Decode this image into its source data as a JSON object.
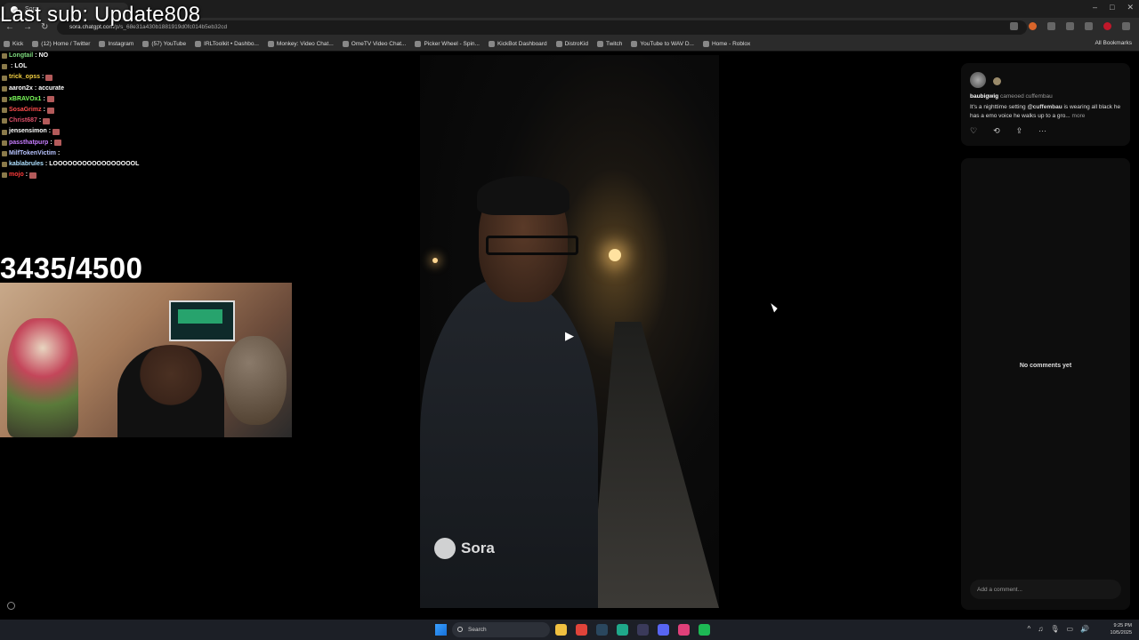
{
  "browser": {
    "tab_title": "Sora",
    "url_host": "sora.chatgpt.com",
    "url_path": "/p/s_68e31a430b1881919d0fc014b5eb32cd",
    "window_controls": [
      "–",
      "□",
      "✕"
    ],
    "nav": [
      "←",
      "→",
      "↻"
    ],
    "bookmarks": [
      "Kick",
      "(12) Home / Twitter",
      "Instagram",
      "(57) YouTube",
      "IRLToolkit • Dashbo...",
      "Monkey: Video Chat...",
      "OmeTV Video Chat...",
      "Picker Wheel - Spin...",
      "KickBot Dashboard",
      "DistroKid",
      "Twitch",
      "YouTube to WAV D...",
      "Home - Roblox"
    ],
    "all_bookmarks": "All Bookmarks"
  },
  "overlay": {
    "last_sub": "Last sub: Update808",
    "counter": "3435/4500",
    "chat": [
      {
        "user": "Longtail",
        "color": "#7dd87d",
        "msg": "NO",
        "emote": false
      },
      {
        "user": "",
        "color": "#ff5c8a",
        "msg": "LOL",
        "emote": false
      },
      {
        "user": "trick_opss",
        "color": "#f5d142",
        "msg": "",
        "emote": true
      },
      {
        "user": "aaron2x",
        "color": "#ffffff",
        "msg": "accurate",
        "emote": false
      },
      {
        "user": "xBRAVOx1",
        "color": "#7dff5c",
        "msg": "",
        "emote": true
      },
      {
        "user": "SosaGrimz",
        "color": "#ff4d4d",
        "msg": "",
        "emote": true
      },
      {
        "user": "Christ687",
        "color": "#e0506a",
        "msg": "",
        "emote": true
      },
      {
        "user": "jensensimon",
        "color": "#ffffff",
        "msg": "",
        "emote": true
      },
      {
        "user": "passthatpurp",
        "color": "#c77dff",
        "msg": "",
        "emote": true
      },
      {
        "user": "MilfTokenVictim",
        "color": "#b8c4ff",
        "msg": "",
        "emote": false
      },
      {
        "user": "kablabrules",
        "color": "#aee0ff",
        "msg": "LOOOOOOOOOOOOOOOOOL",
        "emote": false
      },
      {
        "user": "mojo",
        "color": "#ff3b3b",
        "msg": "",
        "emote": true
      }
    ]
  },
  "video": {
    "watermark": "Sora",
    "play_icon": "▶"
  },
  "post": {
    "username": "baubigwig",
    "action": "cameoed cuffembau",
    "text_prefix": "It's a nighttime setting ",
    "mention": "@cuffembau",
    "text_suffix": " is wearing all black he has a emo voice he walks up to a gro...",
    "more": "more",
    "actions": [
      "♡",
      "⟲",
      "⇪",
      "···"
    ]
  },
  "comments": {
    "empty_text": "No comments yet",
    "input_placeholder": "Add a comment..."
  },
  "taskbar": {
    "search_label": "Search",
    "apps": [
      {
        "name": "file-explorer-icon",
        "color": "#f0c040"
      },
      {
        "name": "chrome-icon",
        "color": "#e0443a"
      },
      {
        "name": "steam-icon",
        "color": "#2a475e"
      },
      {
        "name": "app-green-icon",
        "color": "#1fa88a"
      },
      {
        "name": "obs-icon",
        "color": "#3a3a5a"
      },
      {
        "name": "discord-icon",
        "color": "#5865f2"
      },
      {
        "name": "app-pink-icon",
        "color": "#e0407a"
      },
      {
        "name": "spotify-icon",
        "color": "#1db954"
      }
    ],
    "tray": [
      "^",
      "♫",
      "🎙",
      "▭",
      "🔊"
    ],
    "time": "9:25 PM",
    "date": "10/5/2025"
  }
}
